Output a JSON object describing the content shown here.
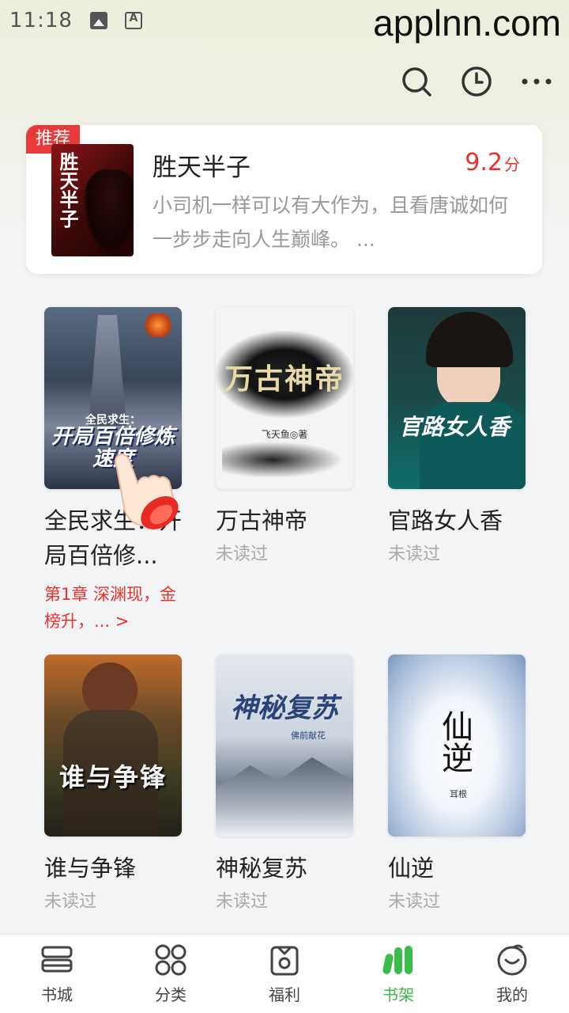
{
  "status_bar": {
    "time": "11:18",
    "icons": [
      "image-icon",
      "font-icon"
    ],
    "watermark": "applnn.com"
  },
  "toolbar": {
    "icons": [
      "search-icon",
      "history-clock-icon",
      "more-dots-icon"
    ]
  },
  "recommend": {
    "badge": "推荐",
    "cover_text": "胜天半子",
    "title": "胜天半子",
    "score": "9.2",
    "score_unit": "分",
    "description": "小司机一样可以有大作为，且看唐诚如何一步步走向人生巅峰。 ..."
  },
  "books": [
    {
      "title": "全民求生：开局百倍修...",
      "cover_text_top": "全民求生：",
      "cover_text_main": "开局百倍修炼速度",
      "progress": "第1章 深渊现，金榜升，... >"
    },
    {
      "title": "万古神帝",
      "cover_text_main": "万古神帝",
      "cover_author": "飞天鱼◎著",
      "status": "未读过"
    },
    {
      "title": "官路女人香",
      "cover_text_main": "官路女人香",
      "status": "未读过"
    },
    {
      "title": "谁与争锋",
      "cover_text_main": "谁与争锋",
      "status": "未读过"
    },
    {
      "title": "神秘复苏",
      "cover_text_main": "神秘复苏",
      "cover_author": "佛前献花",
      "status": "未读过"
    },
    {
      "title": "仙逆",
      "cover_text_main": "仙逆",
      "cover_author": "耳根",
      "status": "未读过"
    }
  ],
  "bottom_nav": {
    "items": [
      {
        "label": "书城",
        "icon": "bookstore-icon"
      },
      {
        "label": "分类",
        "icon": "category-icon"
      },
      {
        "label": "福利",
        "icon": "welfare-icon"
      },
      {
        "label": "书架",
        "icon": "bookshelf-icon",
        "active": true
      },
      {
        "label": "我的",
        "icon": "profile-icon"
      }
    ]
  },
  "colors": {
    "accent_red": "#e8322f",
    "active_green": "#3dbb4a"
  }
}
